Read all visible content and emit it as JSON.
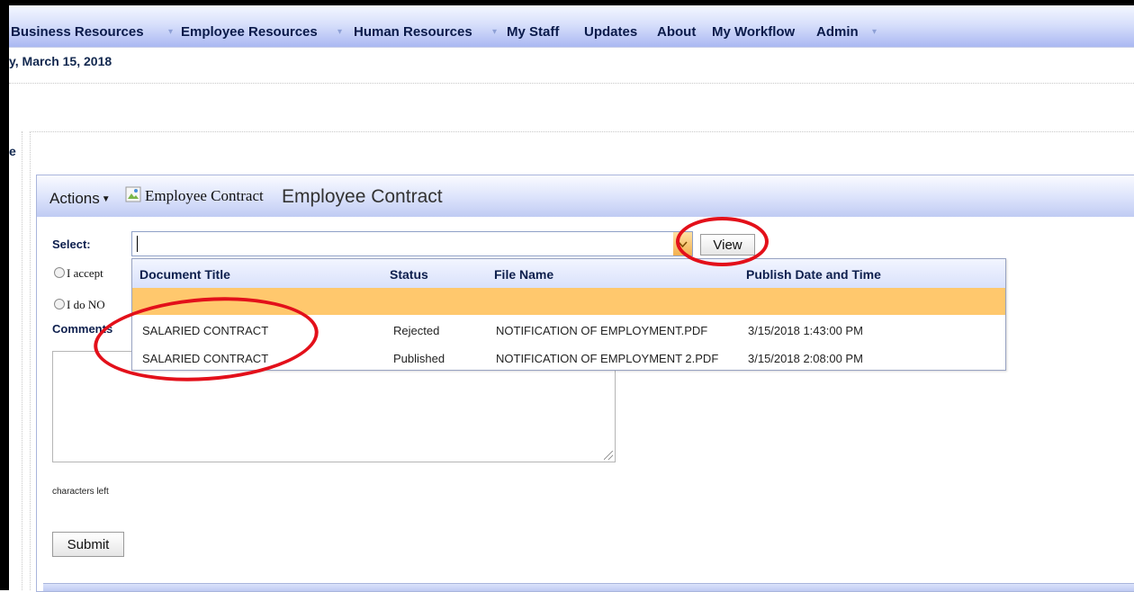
{
  "nav": {
    "items": [
      "Business Resources",
      "Employee Resources",
      "Human Resources",
      "My Staff",
      "Updates",
      "About",
      "My Workflow",
      "Admin"
    ]
  },
  "date_text": "y, March 15, 2018",
  "side_fragment": "e",
  "panel": {
    "actions_label": "Actions",
    "image_alt_text": "Employee Contract",
    "title": "Employee Contract"
  },
  "form": {
    "select_label": "Select:",
    "select_value": "",
    "view_button": "View",
    "radio_accept_label": "I accept",
    "radio_decline_label": "I do NO",
    "comments_label": "Comments",
    "comments_value": "",
    "chars_left_label": "characters left",
    "submit_button": "Submit"
  },
  "dropdown": {
    "headers": [
      "Document Title",
      "Status",
      "File Name",
      "Publish Date and Time"
    ],
    "rows": [
      {
        "title": "",
        "status": "",
        "file": "",
        "date": "",
        "selected": true
      },
      {
        "title": "SALARIED CONTRACT",
        "status": "Rejected",
        "file": "NOTIFICATION OF EMPLOYMENT.PDF",
        "date": "3/15/2018 1:43:00 PM",
        "selected": false
      },
      {
        "title": "SALARIED CONTRACT",
        "status": "Published",
        "file": "NOTIFICATION OF EMPLOYMENT 2.PDF",
        "date": "3/15/2018 2:08:00 PM",
        "selected": false
      }
    ]
  },
  "colors": {
    "selected_row": "#ffc86d",
    "annotation_circle": "#e3101a",
    "header_text": "#0d1f4d"
  }
}
